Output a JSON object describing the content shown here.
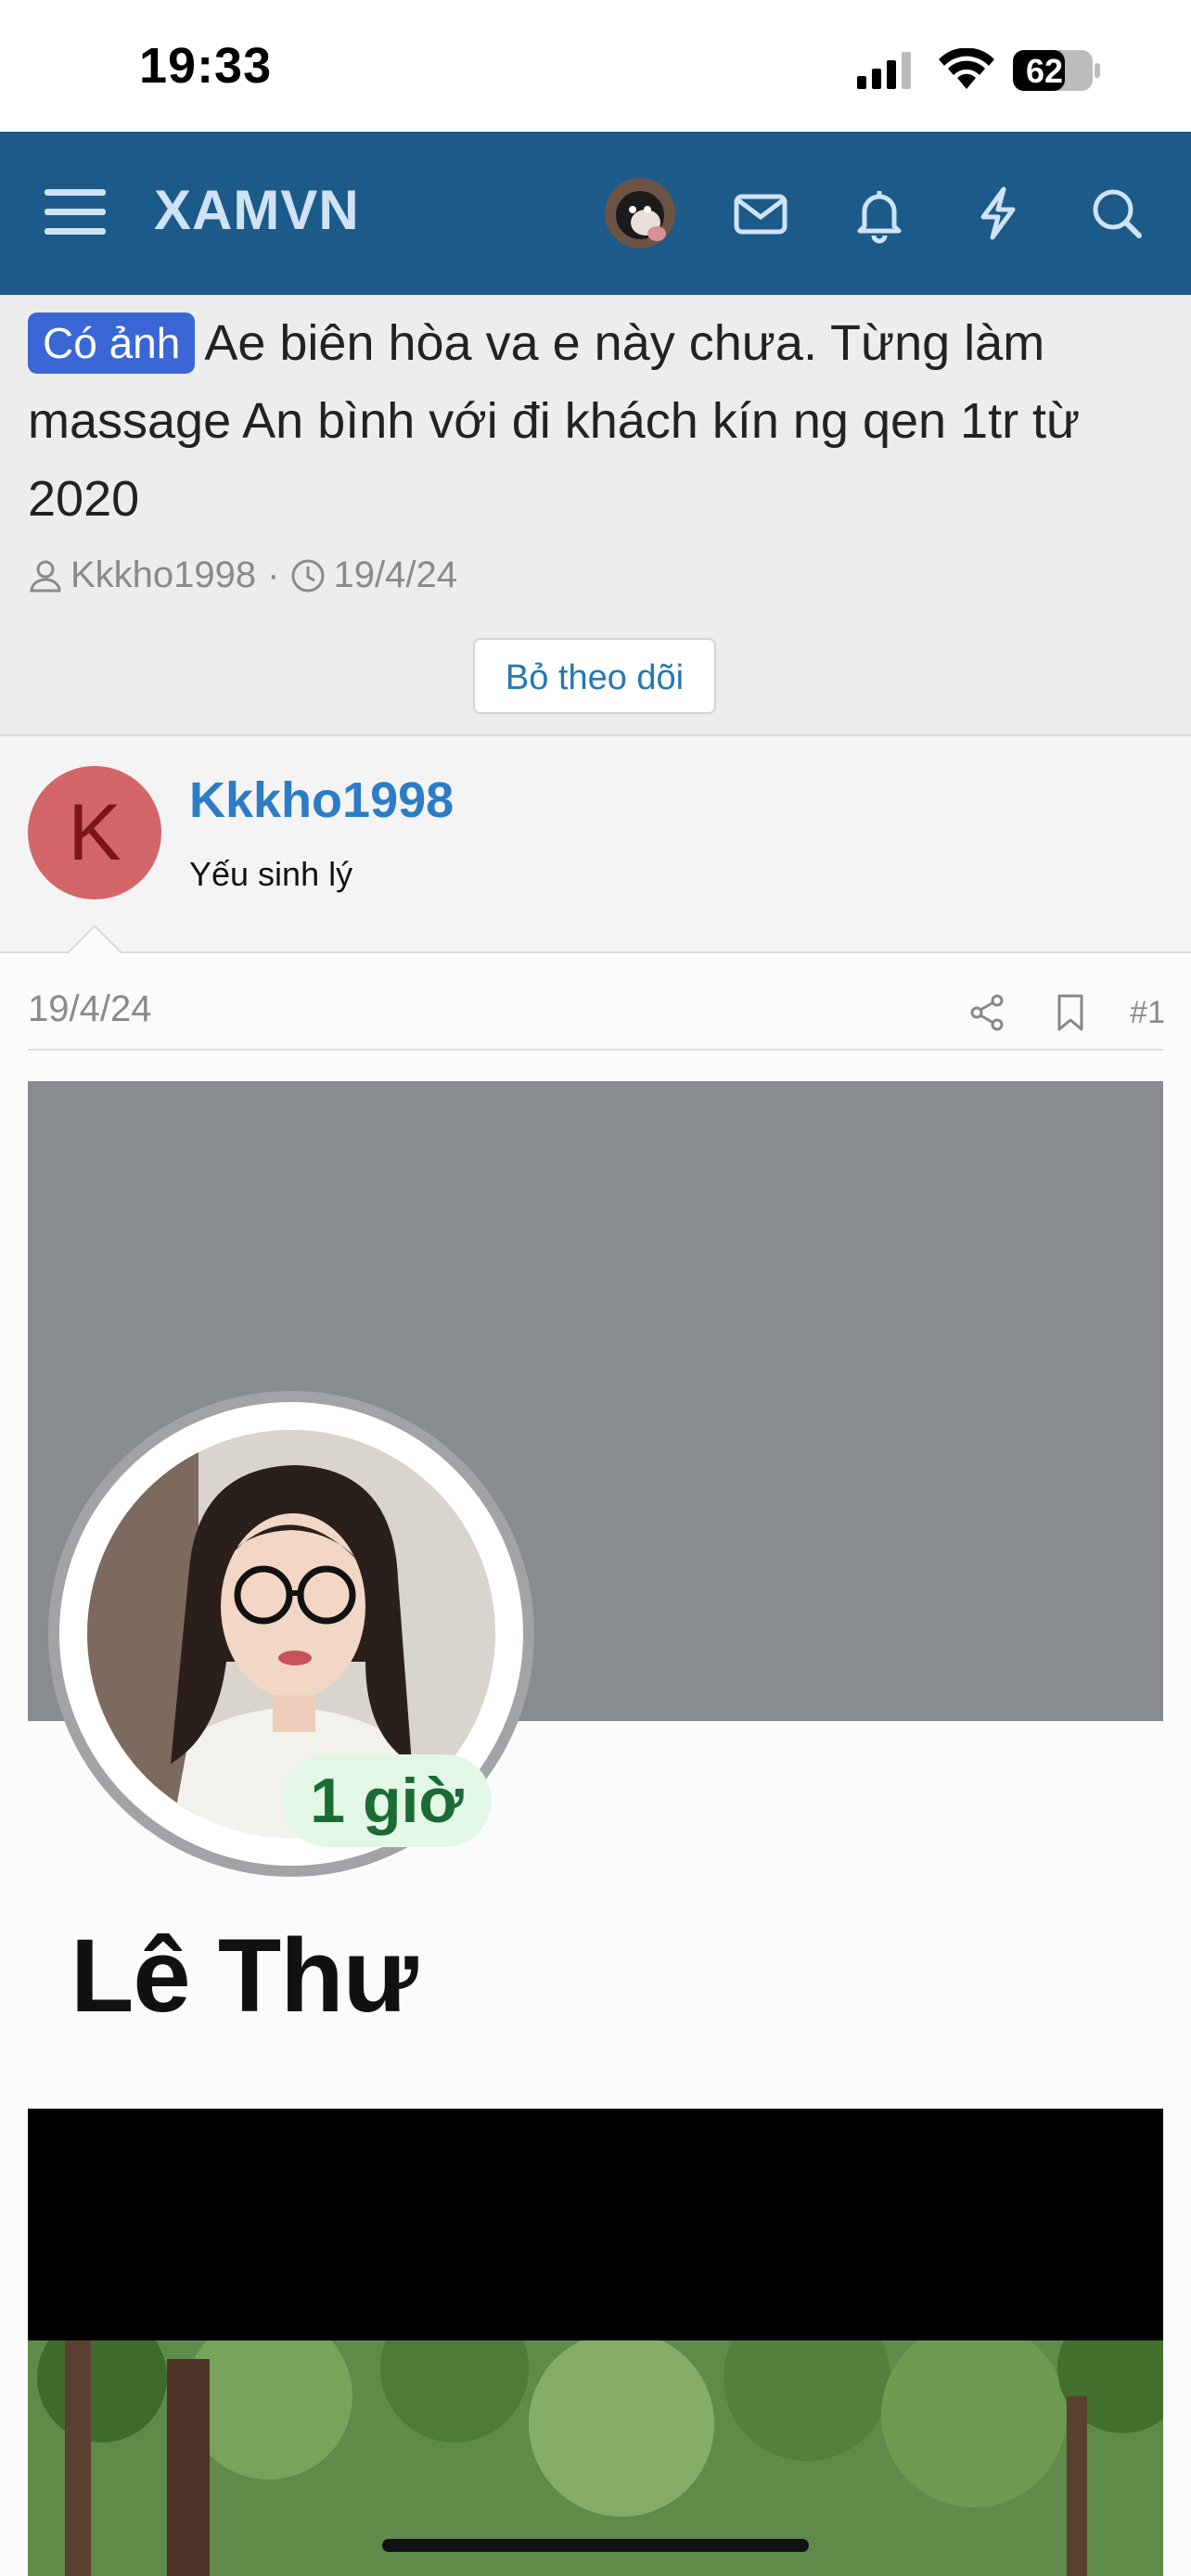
{
  "status_bar": {
    "time": "19:33",
    "battery": "62"
  },
  "navbar": {
    "logo": "XAMVN",
    "icons": [
      "menu-icon",
      "avatar",
      "mail-icon",
      "bell-icon",
      "bolt-icon",
      "search-icon"
    ],
    "background": "#1c5a8a"
  },
  "thread": {
    "prefix": "Có ảnh",
    "title": "Ae biên hòa va e này chưa. Từng làm massage An bình với đi khách kín ng qen 1tr từ 2020",
    "author": "Kkkho1998",
    "separator": "·",
    "date": "19/4/24",
    "unwatch_label": "Bỏ theo dõi"
  },
  "user": {
    "initial": "K",
    "name": "Kkkho1998",
    "title": "Yếu sinh lý",
    "avatar_color": "#d26669"
  },
  "post": {
    "date": "19/4/24",
    "number": "#1",
    "image": {
      "time_badge": "1 giờ",
      "name": "Lê Thư"
    }
  }
}
